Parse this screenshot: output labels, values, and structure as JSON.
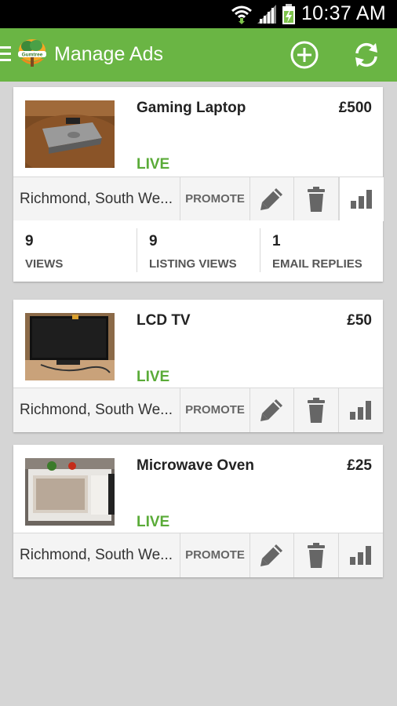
{
  "status_bar": {
    "time": "10:37 AM"
  },
  "app_bar": {
    "title": "Manage Ads",
    "logo_text": "Gumtree"
  },
  "theme": {
    "brand_green": "#6ab544",
    "live_green": "#5aab38"
  },
  "ads": [
    {
      "title": "Gaming Laptop",
      "price": "£500",
      "status": "LIVE",
      "location": "Richmond, South We...",
      "promote_label": "PROMOTE",
      "stats": [
        {
          "value": "9",
          "label": "VIEWS"
        },
        {
          "value": "9",
          "label": "LISTING VIEWS"
        },
        {
          "value": "1",
          "label": "EMAIL REPLIES"
        }
      ]
    },
    {
      "title": "LCD TV",
      "price": "£50",
      "status": "LIVE",
      "location": "Richmond, South We...",
      "promote_label": "PROMOTE"
    },
    {
      "title": "Microwave Oven",
      "price": "£25",
      "status": "LIVE",
      "location": "Richmond, South We...",
      "promote_label": "PROMOTE"
    }
  ],
  "icons": {
    "menu": "menu-icon",
    "add": "add-circle-icon",
    "refresh": "refresh-icon",
    "edit": "pencil-icon",
    "delete": "trash-icon",
    "stats": "bar-chart-icon"
  }
}
